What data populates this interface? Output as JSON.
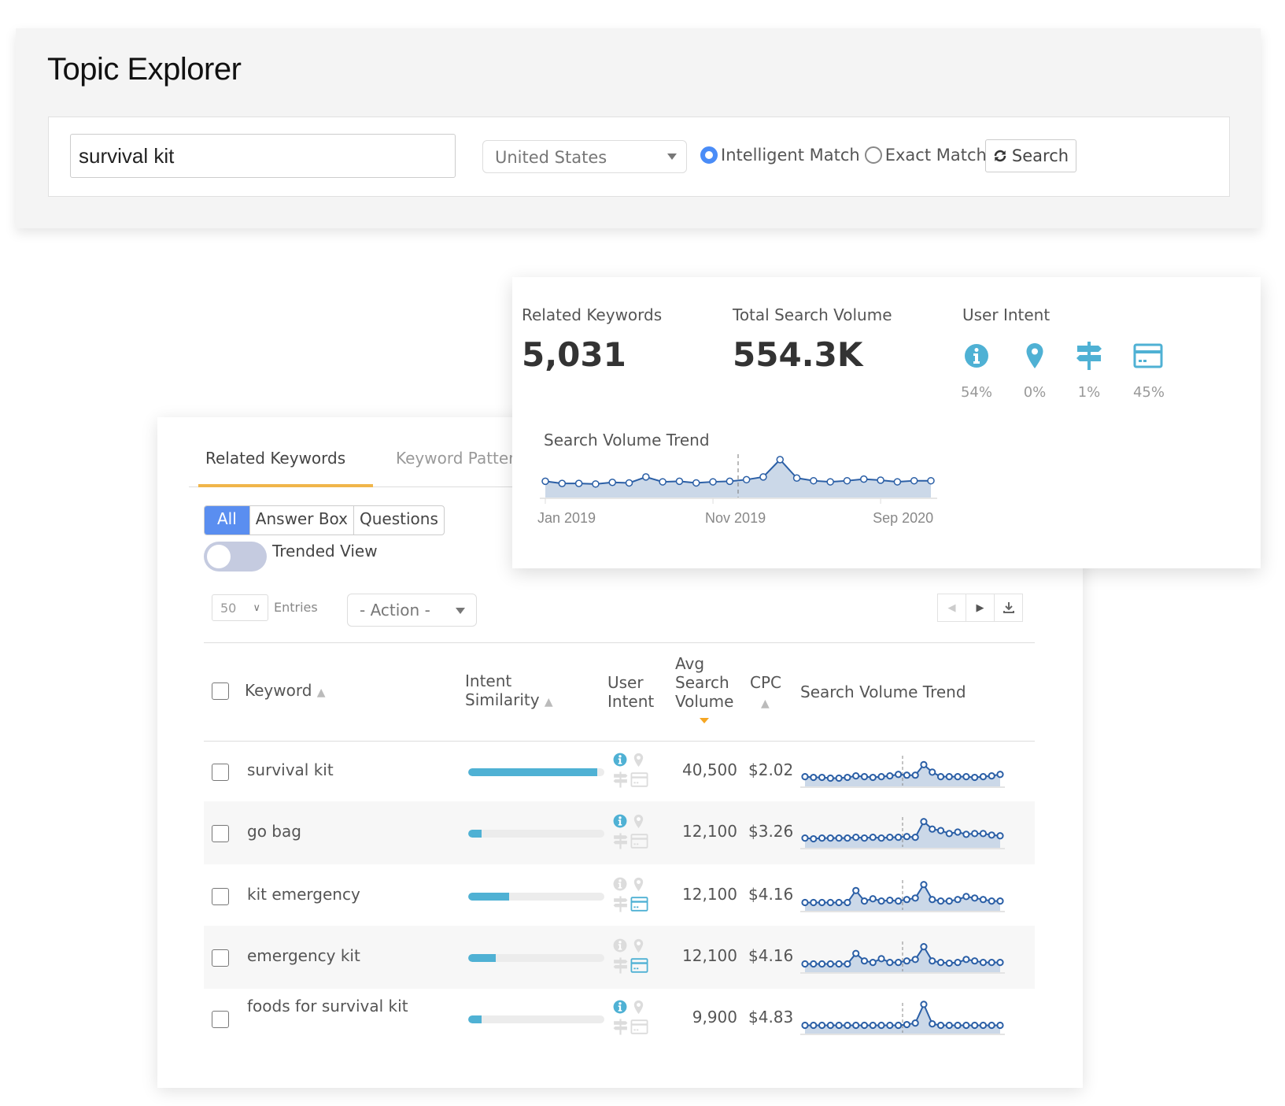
{
  "header": {
    "title": "Topic Explorer"
  },
  "search": {
    "keyword_value": "survival kit",
    "country": "United States",
    "match_options": [
      {
        "label": "Intelligent Match",
        "selected": true
      },
      {
        "label": "Exact Match",
        "selected": false
      }
    ],
    "search_button": "Search",
    "search_icon": "refresh-icon"
  },
  "summary": {
    "related_keywords_label": "Related Keywords",
    "related_keywords_value": "5,031",
    "total_volume_label": "Total Search Volume",
    "total_volume_value": "554.3K",
    "user_intent_label": "User Intent",
    "intents": [
      {
        "icon": "info-icon",
        "name": "Informational",
        "pct": "54%"
      },
      {
        "icon": "location-pin-icon",
        "name": "Local",
        "pct": "0%"
      },
      {
        "icon": "signpost-icon",
        "name": "Navigational",
        "pct": "1%"
      },
      {
        "icon": "credit-card-icon",
        "name": "Transactional",
        "pct": "45%"
      }
    ],
    "trend_title": "Search Volume Trend",
    "trend_colors": {
      "line": "#2b5fa6",
      "fill": "#cbd8e8",
      "accent": "#4fb1d4"
    }
  },
  "chart_data": {
    "type": "area",
    "title": "Search Volume Trend",
    "x_tick_labels": [
      "Jan 2019",
      "Nov 2019",
      "Sep 2020"
    ],
    "x_tick_indices": [
      0,
      10,
      20
    ],
    "marker_index": 11.5,
    "values": [
      30,
      26,
      26,
      25,
      28,
      27,
      38,
      29,
      30,
      27,
      29,
      30,
      33,
      38,
      70,
      36,
      31,
      29,
      31,
      34,
      32,
      29,
      31,
      31
    ],
    "ylim": [
      0,
      80
    ],
    "grid": false,
    "legend": "none"
  },
  "tabs": [
    {
      "label": "Related Keywords",
      "active": true
    },
    {
      "label": "Keyword Patter",
      "active": false
    }
  ],
  "filters": {
    "segments": [
      {
        "label": "All",
        "active": true
      },
      {
        "label": "Answer Box",
        "active": false
      },
      {
        "label": "Questions",
        "active": false
      }
    ],
    "trended_view_label": "Trended View",
    "trended_view_on": false
  },
  "toolbar": {
    "entries_value": "50",
    "entries_label": "Entries",
    "action_label": "- Action -"
  },
  "table": {
    "columns": {
      "keyword": "Keyword",
      "intent_similarity_1": "Intent",
      "intent_similarity_2": "Similarity",
      "user_intent_1": "User",
      "user_intent_2": "Intent",
      "volume_1": "Avg",
      "volume_2": "Search",
      "volume_3": "Volume",
      "cpc": "CPC",
      "trend": "Search Volume Trend"
    },
    "rows": [
      {
        "keyword": "survival kit",
        "similarity": 0.95,
        "intents": {
          "info": true,
          "local": false,
          "nav": false,
          "trans": false
        },
        "volume": "40,500",
        "cpc": "$2.02",
        "trend": [
          12,
          11,
          11,
          10,
          10,
          11,
          13,
          12,
          11,
          12,
          13,
          15,
          14,
          14,
          28,
          18,
          12,
          12,
          12,
          12,
          11,
          12,
          13,
          15
        ]
      },
      {
        "keyword": "go bag",
        "similarity": 0.1,
        "intents": {
          "info": true,
          "local": false,
          "nav": false,
          "trans": false
        },
        "volume": "12,100",
        "cpc": "$3.26",
        "trend": [
          12,
          11,
          12,
          12,
          12,
          12,
          13,
          12,
          13,
          12,
          13,
          13,
          14,
          13,
          34,
          24,
          22,
          18,
          20,
          17,
          18,
          18,
          16,
          15
        ]
      },
      {
        "keyword": "kit emergency",
        "similarity": 0.3,
        "intents": {
          "info": false,
          "local": false,
          "nav": false,
          "trans": true
        },
        "volume": "12,100",
        "cpc": "$4.16",
        "trend": [
          10,
          10,
          10,
          10,
          10,
          10,
          26,
          12,
          15,
          12,
          13,
          12,
          14,
          16,
          34,
          14,
          12,
          12,
          14,
          18,
          16,
          14,
          12,
          12
        ]
      },
      {
        "keyword": "emergency kit",
        "similarity": 0.2,
        "intents": {
          "info": false,
          "local": false,
          "nav": false,
          "trans": true
        },
        "volume": "12,100",
        "cpc": "$4.16",
        "trend": [
          10,
          10,
          10,
          10,
          10,
          10,
          24,
          14,
          12,
          17,
          12,
          12,
          14,
          16,
          33,
          14,
          12,
          11,
          12,
          16,
          14,
          12,
          12,
          12
        ]
      },
      {
        "keyword": "foods for survival kit",
        "similarity": 0.1,
        "intents": {
          "info": true,
          "local": false,
          "nav": false,
          "trans": false
        },
        "volume": "9,900",
        "cpc": "$4.83",
        "trend": [
          10,
          10,
          10,
          10,
          10,
          10,
          10,
          10,
          10,
          10,
          10,
          10,
          11,
          13,
          38,
          12,
          10,
          10,
          10,
          10,
          10,
          10,
          10,
          10
        ]
      }
    ]
  }
}
